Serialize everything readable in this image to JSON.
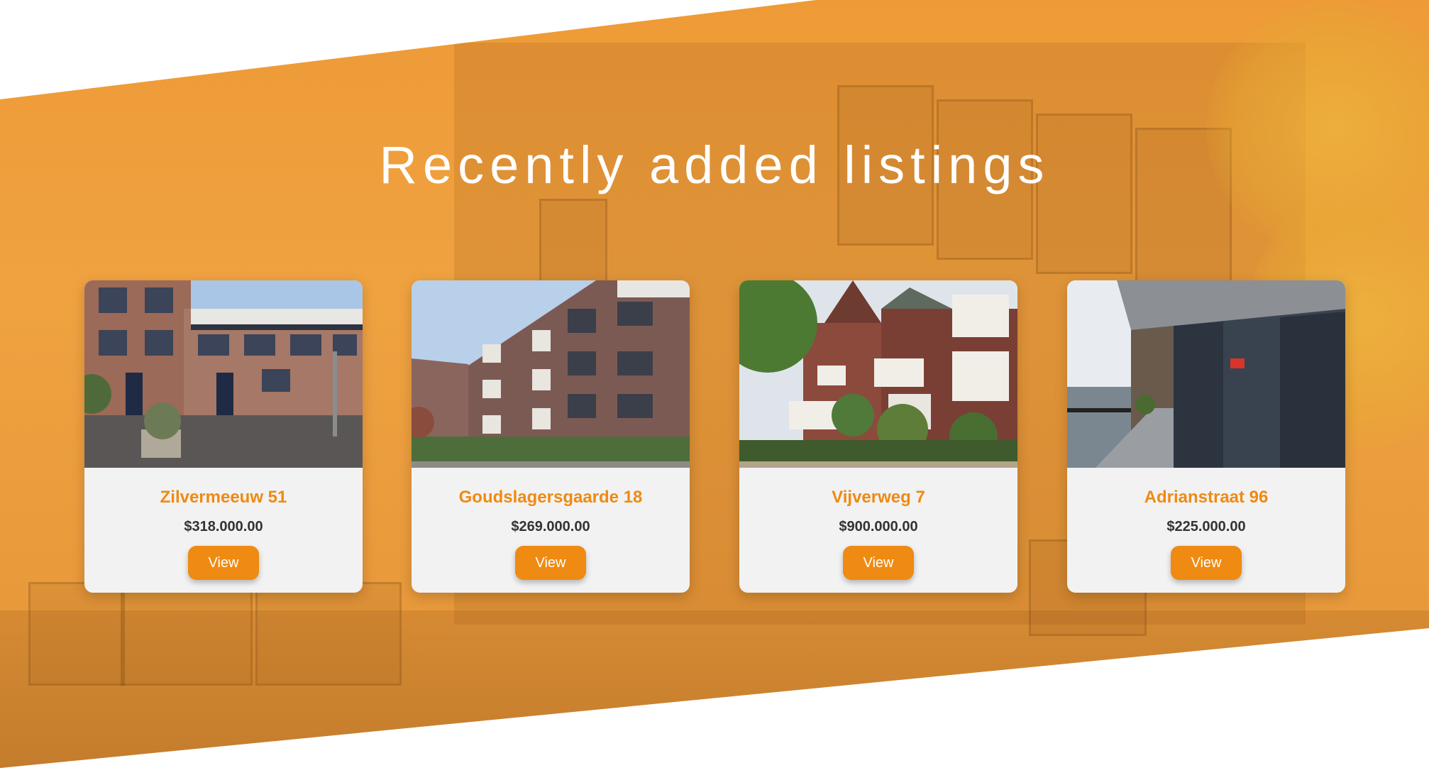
{
  "section": {
    "title": "Recently added listings",
    "accent_color": "#ef8a12"
  },
  "listings": [
    {
      "name": "Zilvermeeuw 51",
      "price": "$318.000.00",
      "button": "View"
    },
    {
      "name": "Goudslagersgaarde 18",
      "price": "$269.000.00",
      "button": "View"
    },
    {
      "name": "Vijverweg 7",
      "price": "$900.000.00",
      "button": "View"
    },
    {
      "name": "Adrianstraat 96",
      "price": "$225.000.00",
      "button": "View"
    }
  ]
}
